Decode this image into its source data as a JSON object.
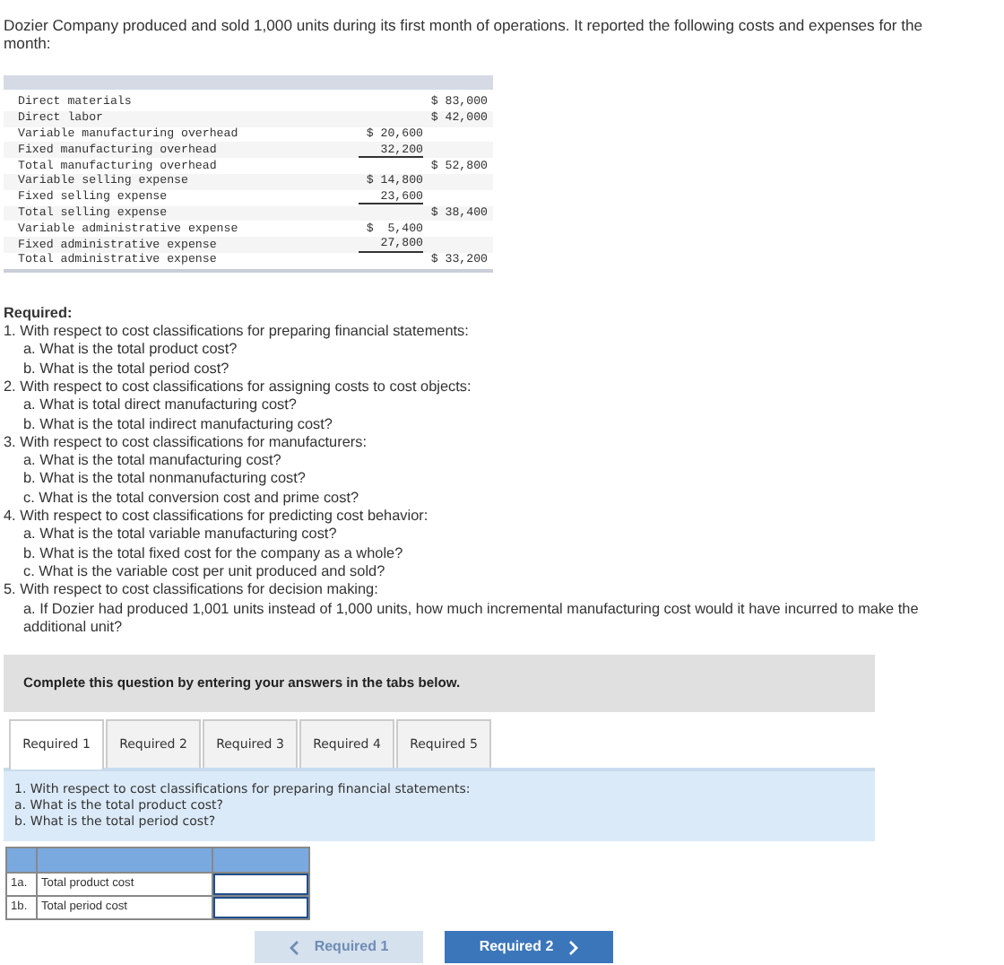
{
  "intro": "Dozier Company produced and sold 1,000 units during its first month of operations. It reported the following costs and expenses for the month:",
  "cost_table": {
    "rows": [
      {
        "label": "Direct materials",
        "amount": "",
        "total": "$ 83,000",
        "underlined": false
      },
      {
        "label": "Direct labor",
        "amount": "",
        "total": "$ 42,000",
        "underlined": false
      },
      {
        "label": "Variable manufacturing overhead",
        "amount": "$ 20,600",
        "total": "",
        "underlined": false
      },
      {
        "label": "Fixed manufacturing overhead",
        "amount": "32,200",
        "total": "",
        "underlined": true
      },
      {
        "label": "Total manufacturing overhead",
        "amount": "",
        "total": "$ 52,800",
        "underlined": false
      },
      {
        "label": "Variable selling expense",
        "amount": "$ 14,800",
        "total": "",
        "underlined": false
      },
      {
        "label": "Fixed selling expense",
        "amount": "23,600",
        "total": "",
        "underlined": true
      },
      {
        "label": "Total selling expense",
        "amount": "",
        "total": "$ 38,400",
        "underlined": false
      },
      {
        "label": "Variable administrative expense",
        "amount": "$  5,400",
        "total": "",
        "underlined": false
      },
      {
        "label": "Fixed administrative expense",
        "amount": "27,800",
        "total": "",
        "underlined": true
      },
      {
        "label": "Total administrative expense",
        "amount": "",
        "total": "$ 33,200",
        "underlined": false
      }
    ]
  },
  "required": {
    "heading": "Required:",
    "items": [
      {
        "text": "1. With respect to cost classifications for preparing financial statements:",
        "children": [
          {
            "text": "a. What is the total product cost?"
          },
          {
            "text": "b. What is the total period cost?"
          }
        ]
      },
      {
        "text": "2. With respect to cost classifications for assigning costs to cost objects:",
        "children": [
          {
            "text": "a. What is total direct manufacturing cost?"
          },
          {
            "text": "b. What is the total indirect manufacturing cost?"
          }
        ]
      },
      {
        "text": "3. With respect to cost classifications for manufacturers:",
        "children": [
          {
            "text": "a. What is the total manufacturing cost?"
          },
          {
            "text": "b. What is the total nonmanufacturing cost?"
          },
          {
            "text": "c. What is the total conversion cost and prime cost?"
          }
        ]
      },
      {
        "text": "4. With respect to cost classifications for predicting cost behavior:",
        "children": [
          {
            "text": "a. What is the total variable manufacturing cost?"
          },
          {
            "text": "b. What is the total fixed cost for the company as a whole?"
          },
          {
            "text": "c. What is the variable cost per unit produced and sold?"
          }
        ]
      },
      {
        "text": "5. With respect to cost classifications for decision making:",
        "children": [
          {
            "text": "a. If Dozier had produced 1,001 units instead of 1,000 units, how much incremental manufacturing cost would it have incurred to make the additional unit?"
          }
        ]
      }
    ]
  },
  "instruction": "Complete this question by entering your answers in the tabs below.",
  "tabs": [
    {
      "label": "Required 1",
      "selected": true
    },
    {
      "label": "Required 2",
      "selected": false
    },
    {
      "label": "Required 3",
      "selected": false
    },
    {
      "label": "Required 4",
      "selected": false
    },
    {
      "label": "Required 5",
      "selected": false
    }
  ],
  "tab_prompt": [
    "1. With respect to cost classifications for preparing financial statements:",
    "a. What is the total product cost?",
    "b. What is the total period cost?"
  ],
  "answer_rows": [
    {
      "id": "1a.",
      "label": "Total product cost"
    },
    {
      "id": "1b.",
      "label": "Total period cost"
    }
  ],
  "nav": {
    "prev": {
      "label": "Required 1",
      "disabled": true
    },
    "next": {
      "label": "Required 2",
      "disabled": false
    }
  }
}
